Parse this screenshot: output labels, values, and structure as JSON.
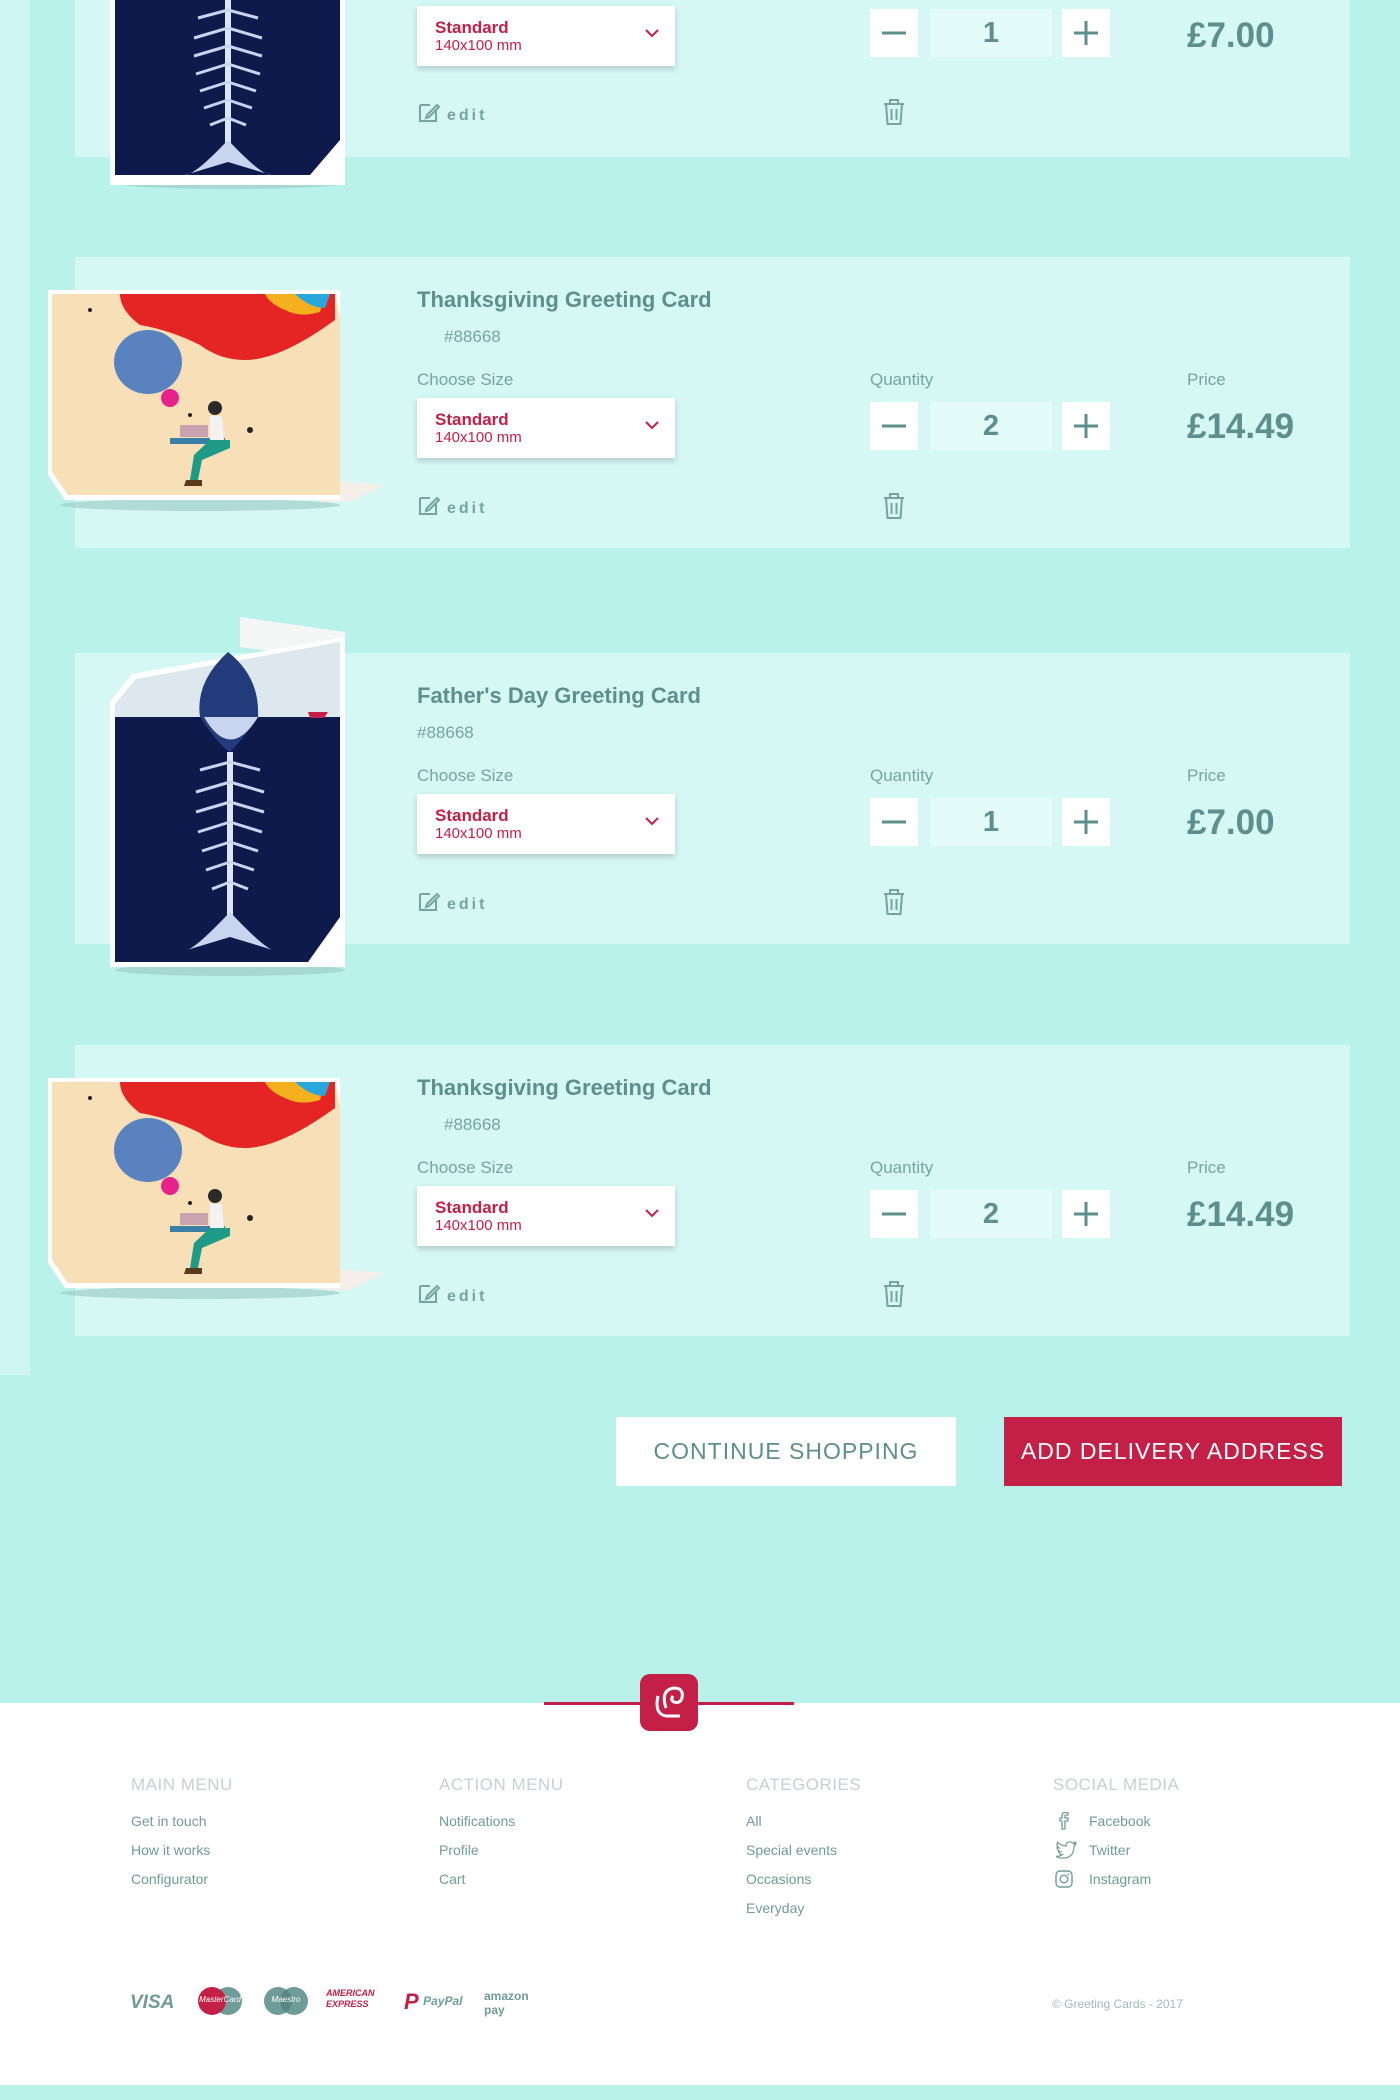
{
  "cart": {
    "items": [
      {
        "title": "",
        "sku": "",
        "size_label": "",
        "size_name": "Standard",
        "size_dims": "140x100 mm",
        "quantity_label": "",
        "quantity": "1",
        "price_label": "",
        "price": "£7.00",
        "edit_label": "edit",
        "image": "fish-skeleton-card"
      },
      {
        "title": "Thanksgiving Greeting Card",
        "sku": "#88668",
        "size_label": "Choose Size",
        "size_name": "Standard",
        "size_dims": "140x100 mm",
        "quantity_label": "Quantity",
        "quantity": "2",
        "price_label": "Price",
        "price": "£14.49",
        "edit_label": "edit",
        "image": "thinker-typewriter-card"
      },
      {
        "title": "Father's Day Greeting Card",
        "sku": "#88668",
        "size_label": "Choose Size",
        "size_name": "Standard",
        "size_dims": "140x100 mm",
        "quantity_label": "Quantity",
        "quantity": "1",
        "price_label": "Price",
        "price": "£7.00",
        "edit_label": "edit",
        "image": "fish-skeleton-card"
      },
      {
        "title": "Thanksgiving Greeting Card",
        "sku": "#88668",
        "size_label": "Choose Size",
        "size_name": "Standard",
        "size_dims": "140x100 mm",
        "quantity_label": "Quantity",
        "quantity": "2",
        "price_label": "Price",
        "price": "£14.49",
        "edit_label": "edit",
        "image": "thinker-typewriter-card"
      }
    ]
  },
  "actions": {
    "continue_label": "CONTINUE SHOPPING",
    "delivery_label": "ADD DELIVERY ADDRESS"
  },
  "footer": {
    "main_menu": {
      "heading": "MAIN MENU",
      "links": [
        "Get in touch",
        "How it works",
        "Configurator"
      ]
    },
    "action_menu": {
      "heading": "ACTION MENU",
      "links": [
        "Notifications",
        "Profile",
        "Cart"
      ]
    },
    "categories": {
      "heading": "CATEGORIES",
      "links": [
        "All",
        "Special events",
        "Occasions",
        "Everyday"
      ]
    },
    "social": {
      "heading": "SOCIAL MEDIA",
      "links": [
        {
          "label": "Facebook",
          "icon": "facebook-icon"
        },
        {
          "label": "Twitter",
          "icon": "twitter-icon"
        },
        {
          "label": "Instagram",
          "icon": "instagram-icon"
        }
      ]
    },
    "payments": [
      "VISA",
      "MasterCard",
      "Maestro",
      "AMERICAN EXPRESS",
      "PayPal",
      "amazon pay"
    ],
    "copyright": "© Greeting Cards - 2017"
  },
  "colors": {
    "accent": "#c41f46",
    "text": "#5d8f8c",
    "background": "#b9f1eb",
    "card": "#d6f8f5"
  }
}
